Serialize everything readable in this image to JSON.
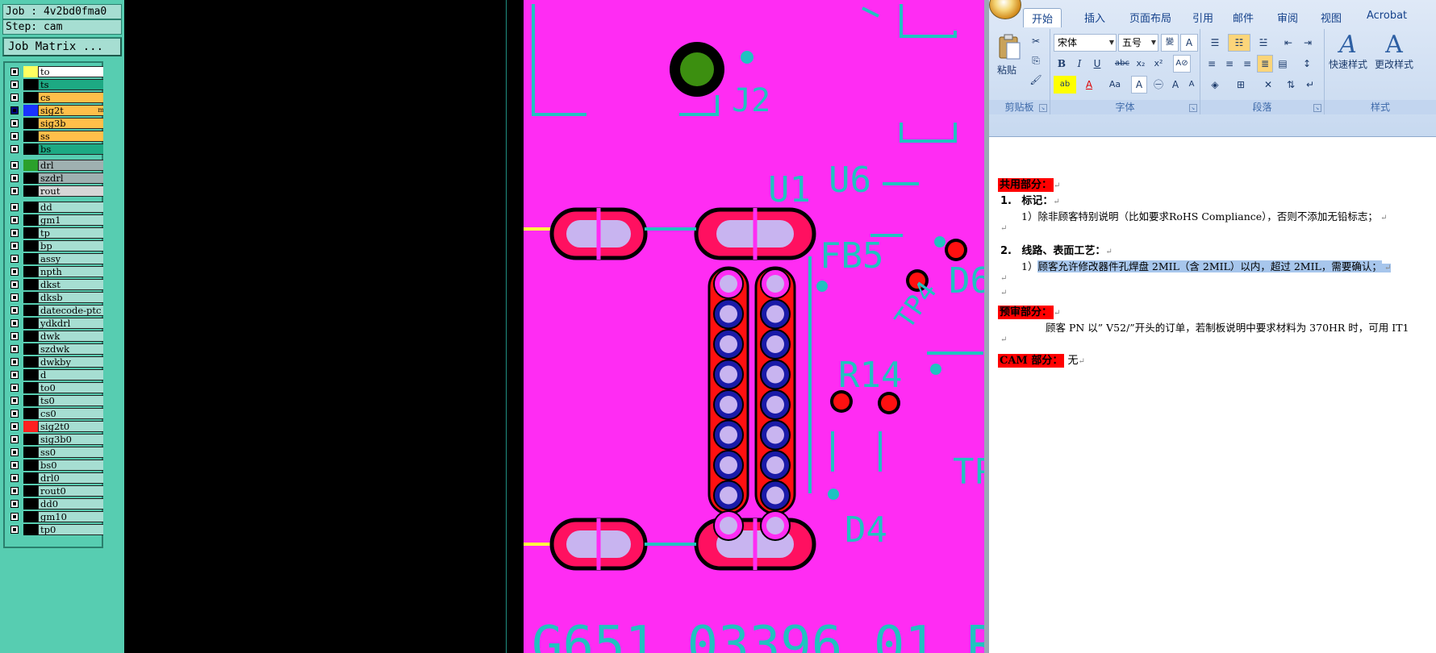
{
  "cam": {
    "job_line": "Job : 4v2bd0fma0",
    "step_line": "Step: cam",
    "job_matrix_label": "Job Matrix ...",
    "layers": [
      {
        "name": "to",
        "swatch": "#ffff60",
        "bg": "#ffffff"
      },
      {
        "name": "ts",
        "swatch": "#000000",
        "bg": "#1da983"
      },
      {
        "name": "cs",
        "swatch": "#000000",
        "bg": "#ffbf4a"
      },
      {
        "name": "sig2t",
        "swatch": "#1a33ff",
        "bg": "#ffbf4a",
        "active": true,
        "marker": "m"
      },
      {
        "name": "sig3b",
        "swatch": "#000000",
        "bg": "#ffbf4a"
      },
      {
        "name": "ss",
        "swatch": "#000000",
        "bg": "#ffbf4a"
      },
      {
        "name": "bs",
        "swatch": "#000000",
        "bg": "#1da983"
      },
      {
        "name": "drl",
        "swatch": "#2ba02b",
        "bg": "#9fb0b0",
        "gap": true
      },
      {
        "name": "szdrl",
        "swatch": "#000000",
        "bg": "#9fb0b0"
      },
      {
        "name": "rout",
        "swatch": "#000000",
        "bg": "#d6d6d6"
      },
      {
        "name": "dd",
        "swatch": "#000000",
        "bg": "#a6ded2",
        "gap": true
      },
      {
        "name": "gm1",
        "swatch": "#000000",
        "bg": "#a6ded2"
      },
      {
        "name": "tp",
        "swatch": "#000000",
        "bg": "#a6ded2"
      },
      {
        "name": "bp",
        "swatch": "#000000",
        "bg": "#a6ded2"
      },
      {
        "name": "assy",
        "swatch": "#000000",
        "bg": "#a6ded2"
      },
      {
        "name": "npth",
        "swatch": "#000000",
        "bg": "#a6ded2"
      },
      {
        "name": "dkst",
        "swatch": "#000000",
        "bg": "#a6ded2"
      },
      {
        "name": "dksb",
        "swatch": "#000000",
        "bg": "#a6ded2"
      },
      {
        "name": "datecode-ptc",
        "swatch": "#000000",
        "bg": "#a6ded2"
      },
      {
        "name": "ydkdrl",
        "swatch": "#000000",
        "bg": "#a6ded2"
      },
      {
        "name": "dwk",
        "swatch": "#000000",
        "bg": "#a6ded2"
      },
      {
        "name": "szdwk",
        "swatch": "#000000",
        "bg": "#a6ded2"
      },
      {
        "name": "dwkby",
        "swatch": "#000000",
        "bg": "#a6ded2"
      },
      {
        "name": "d",
        "swatch": "#000000",
        "bg": "#a6ded2"
      },
      {
        "name": "to0",
        "swatch": "#000000",
        "bg": "#a6ded2"
      },
      {
        "name": "ts0",
        "swatch": "#000000",
        "bg": "#a6ded2"
      },
      {
        "name": "cs0",
        "swatch": "#000000",
        "bg": "#a6ded2"
      },
      {
        "name": "sig2t0",
        "swatch": "#ff2020",
        "bg": "#a6ded2"
      },
      {
        "name": "sig3b0",
        "swatch": "#000000",
        "bg": "#a6ded2"
      },
      {
        "name": "ss0",
        "swatch": "#000000",
        "bg": "#a6ded2"
      },
      {
        "name": "bs0",
        "swatch": "#000000",
        "bg": "#a6ded2"
      },
      {
        "name": "drl0",
        "swatch": "#000000",
        "bg": "#a6ded2"
      },
      {
        "name": "rout0",
        "swatch": "#000000",
        "bg": "#a6ded2"
      },
      {
        "name": "dd0",
        "swatch": "#000000",
        "bg": "#a6ded2"
      },
      {
        "name": "gm10",
        "swatch": "#000000",
        "bg": "#a6ded2"
      },
      {
        "name": "tp0",
        "swatch": "#000000",
        "bg": "#a6ded2"
      }
    ]
  },
  "pcb": {
    "labels": [
      "J2",
      "U1",
      "U6",
      "FB5",
      "D6",
      "TP4",
      "R14",
      "D4",
      "TP",
      "G651  03396  01  R"
    ],
    "colors": {
      "board": "#ff2cf3",
      "silk": "#20c2c0",
      "pad": "#c8b4f0",
      "drill": "#ff1010",
      "via_ring": "#1a1aa8"
    }
  },
  "word": {
    "tabs": [
      "开始",
      "插入",
      "页面布局",
      "引用",
      "邮件",
      "审阅",
      "视图",
      "Acrobat"
    ],
    "active_tab": "开始",
    "clipboard": {
      "paste_label": "粘贴",
      "group_label": "剪贴板"
    },
    "font": {
      "name": "宋体",
      "size": "五号",
      "group_label": "字体"
    },
    "paragraph": {
      "group_label": "段落"
    },
    "styles": {
      "quick_label": "快速样式",
      "change_label": "更改样式",
      "group_label": "样式"
    },
    "doc": {
      "h1": "共用部分：",
      "item1_num": "1.",
      "item1_title": "标记：",
      "item1_line": "1）除非顾客特别说明（比如要求RoHS Compliance），否则不添加无铅标志；",
      "item2_num": "2.",
      "item2_title": "线路、表面工艺：",
      "item2_prefix": "1）",
      "item2_selected": "顾客允许修改器件孔焊盘 2MIL（含 2MIL）以内，超过 2MIL，需要确认；",
      "h2": "预审部分：",
      "review_line": "顾客 PN 以” V52/”开头的订单，若制板说明中要求材料为 370HR 时，可用 IT1",
      "h3": "CAM 部分：",
      "cam_text": "无"
    }
  }
}
